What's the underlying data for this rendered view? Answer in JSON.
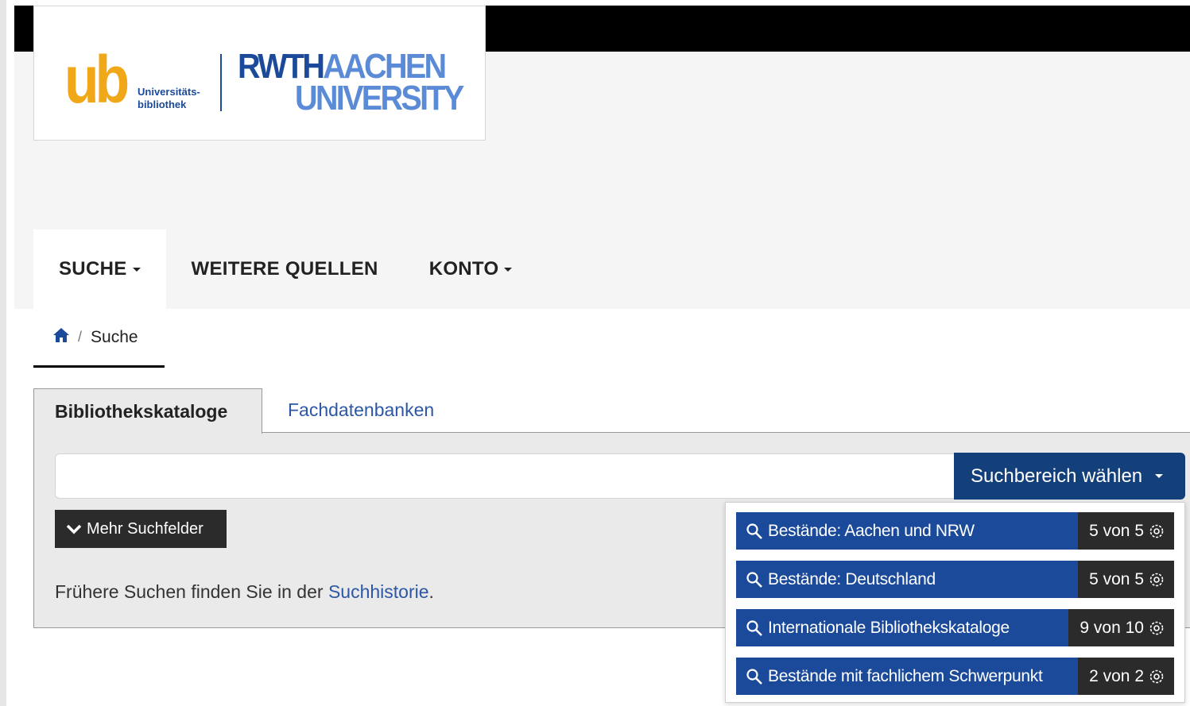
{
  "logo": {
    "ub_letters": "ub",
    "ub_line1": "Universitäts-",
    "ub_line2": "bibliothek",
    "rwth_dark": "RWTH",
    "rwth_light": "AACHEN",
    "rwth_line2": "UNIVERSITY"
  },
  "nav": {
    "items": [
      {
        "label": "SUCHE",
        "has_caret": true,
        "active": true
      },
      {
        "label": "WEITERE QUELLEN",
        "has_caret": false,
        "active": false
      },
      {
        "label": "KONTO",
        "has_caret": true,
        "active": false
      }
    ]
  },
  "breadcrumb": {
    "home_icon": "home-icon",
    "separator": "/",
    "current": "Suche"
  },
  "tabs": {
    "active": "Bibliothekskataloge",
    "other": "Fachdatenbanken"
  },
  "search": {
    "value": "",
    "placeholder": "",
    "scope_button": "Suchbereich wählen"
  },
  "more_fields_button": "Mehr Suchfelder",
  "history": {
    "prefix": "Frühere Suchen finden Sie in der ",
    "link": "Suchhistorie",
    "suffix": "."
  },
  "scope_menu": {
    "items": [
      {
        "label": "Bestände: Aachen und NRW",
        "count": "5 von 5"
      },
      {
        "label": "Bestände: Deutschland",
        "count": "5 von 5"
      },
      {
        "label": "Internationale Bibliothekskataloge",
        "count": "9 von 10"
      },
      {
        "label": "Bestände mit fachlichem Schwerpunkt",
        "count": "2 von 2"
      }
    ]
  },
  "colors": {
    "primary": "#1b4a9a",
    "primary_dark": "#133f7a",
    "link": "#2b57a5",
    "ub_orange": "#f0a818",
    "dark_button": "#2b2b2b"
  }
}
